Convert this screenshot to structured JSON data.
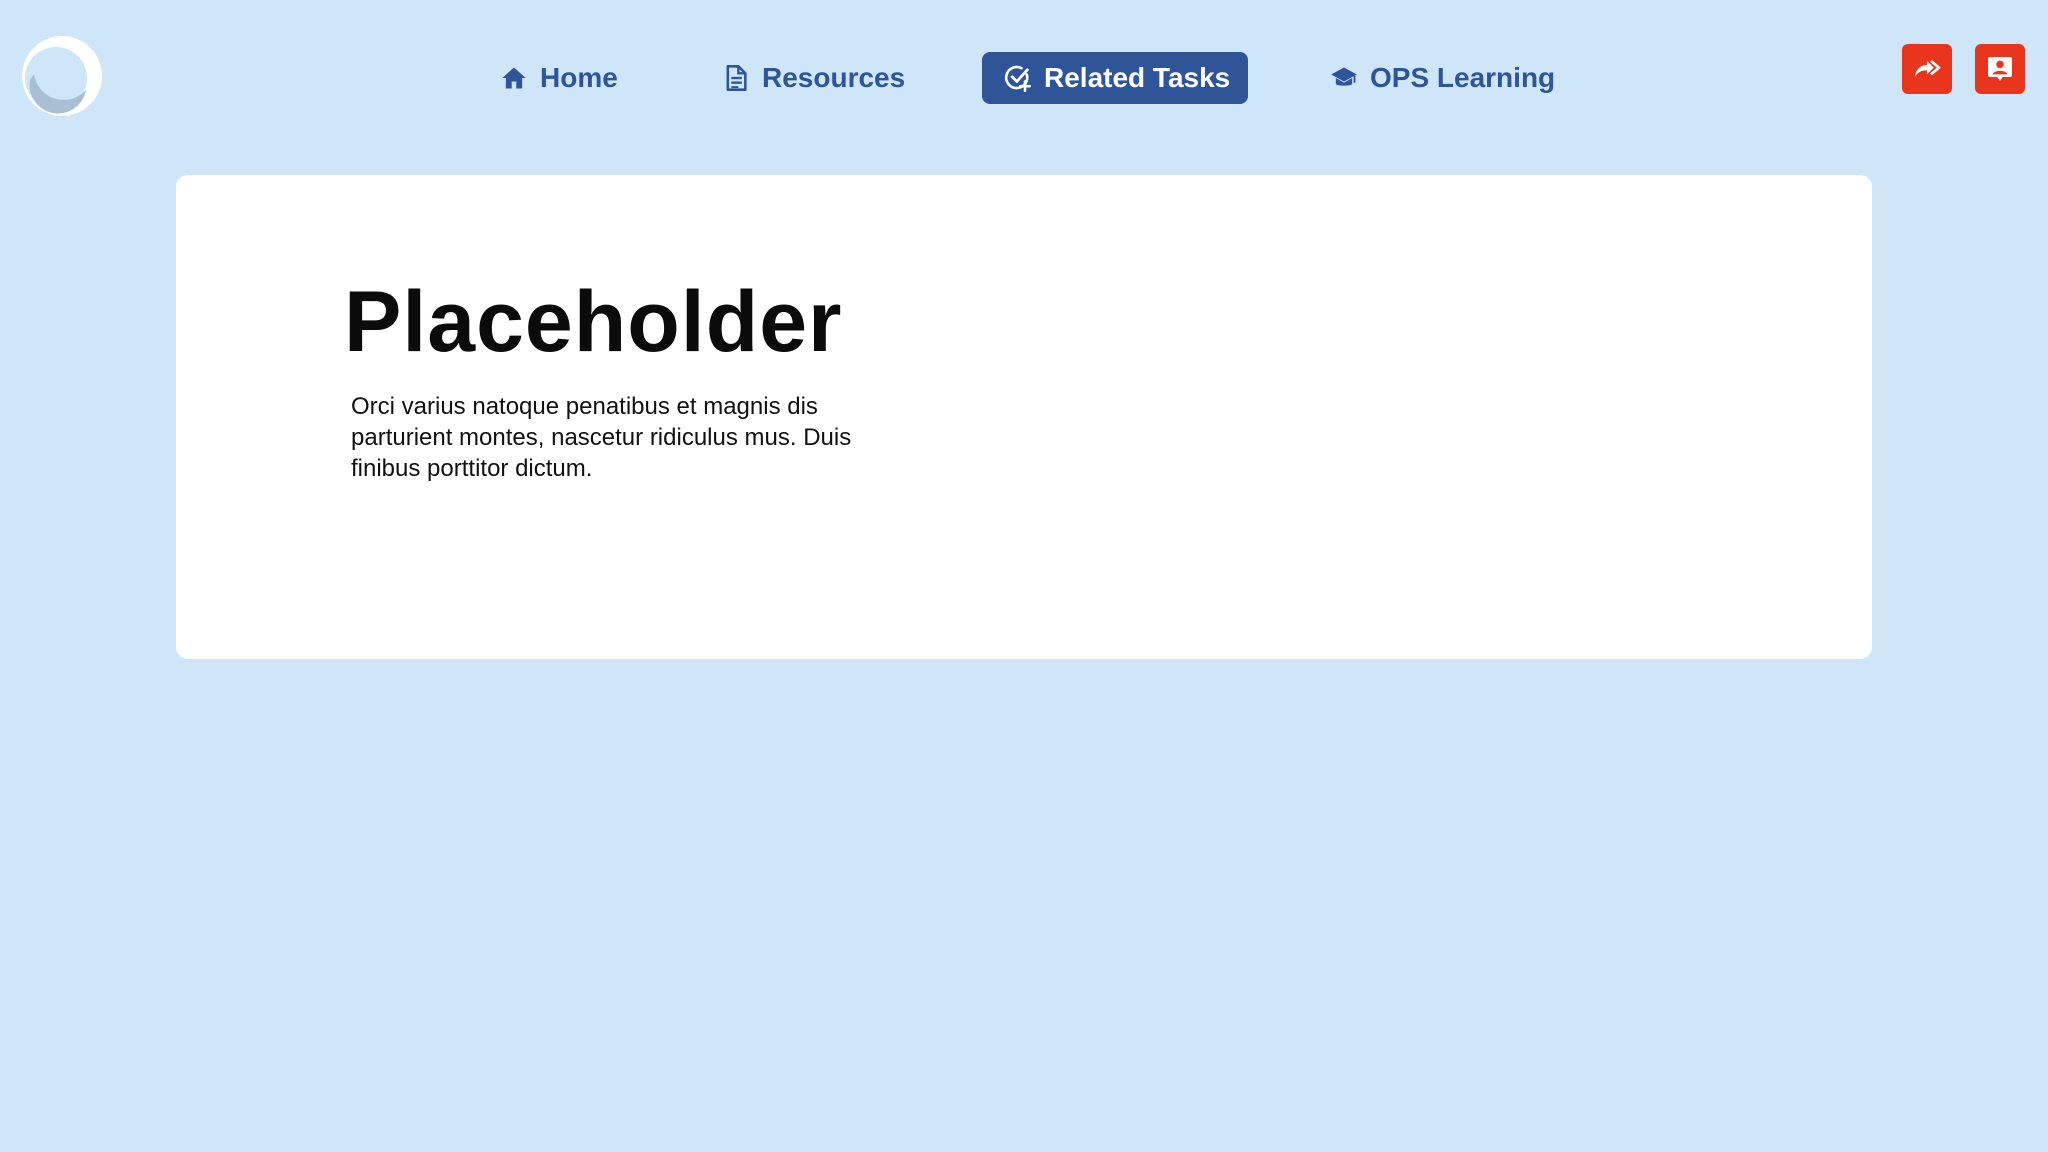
{
  "nav": {
    "items": [
      {
        "label": "Home",
        "icon": "home-icon"
      },
      {
        "label": "Resources",
        "icon": "document-icon"
      },
      {
        "label": "Related Tasks",
        "icon": "task-check-icon",
        "active": true
      },
      {
        "label": "OPS Learning",
        "icon": "graduation-cap-icon"
      }
    ]
  },
  "actions": {
    "share_icon": "double-arrow-forward-icon",
    "contact_icon": "contact-card-icon",
    "color": "#e8351c"
  },
  "card": {
    "title": "Placeholder",
    "body": "Orci varius natoque penatibus et magnis dis parturient montes, nascetur ridiculus mus. Duis finibus porttitor dictum."
  },
  "colors": {
    "background": "#cfe5f8",
    "accent": "#2f5599",
    "card": "#ffffff"
  }
}
